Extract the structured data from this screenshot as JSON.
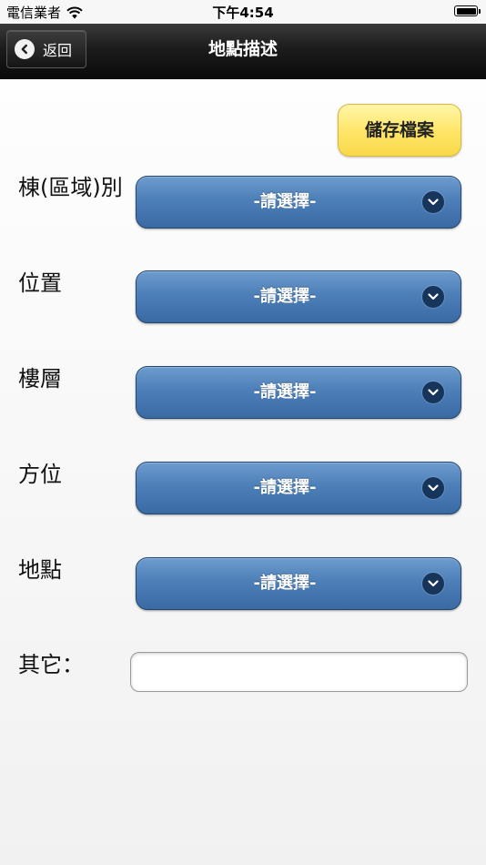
{
  "status_bar": {
    "carrier": "電信業者",
    "time": "下午4:54"
  },
  "nav": {
    "back_label": "返回",
    "title": "地點描述"
  },
  "save_label": "儲存檔案",
  "fields": [
    {
      "label": "棟(區域)別",
      "value": "-請選擇-"
    },
    {
      "label": "位置",
      "value": "-請選擇-"
    },
    {
      "label": "樓層",
      "value": "-請選擇-"
    },
    {
      "label": "方位",
      "value": "-請選擇-"
    },
    {
      "label": "地點",
      "value": "-請選擇-"
    }
  ],
  "other": {
    "label": "其它：",
    "value": ""
  },
  "colors": {
    "select_top": "#6d9cce",
    "select_bottom": "#3a6aa3",
    "save_button": "#ffe566",
    "nav_bar": "#1c1c1c"
  },
  "icons": [
    "wifi-icon",
    "battery-icon",
    "back-arrow-icon",
    "chevron-down-icon"
  ]
}
